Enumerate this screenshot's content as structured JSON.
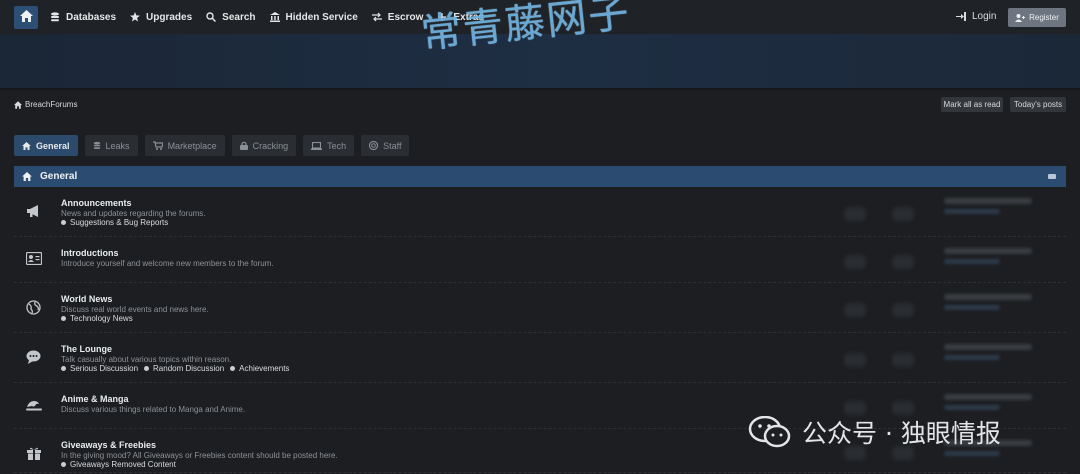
{
  "nav": {
    "items": [
      {
        "label": "Databases",
        "icon": "database-icon"
      },
      {
        "label": "Upgrades",
        "icon": "star-icon"
      },
      {
        "label": "Search",
        "icon": "search-icon"
      },
      {
        "label": "Hidden Service",
        "icon": "building-icon"
      },
      {
        "label": "Escrow",
        "icon": "swap-icon"
      },
      {
        "label": "Extras",
        "icon": "plus-icon"
      }
    ],
    "login": "Login",
    "register": "Register"
  },
  "watermark_top": "常青藤网子",
  "breadcrumb": "BreachForums",
  "actions": {
    "mark_read": "Mark all as read",
    "todays_posts": "Today's posts"
  },
  "tabs": [
    "General",
    "Leaks",
    "Marketplace",
    "Cracking",
    "Tech",
    "Staff"
  ],
  "section": {
    "title": "General"
  },
  "forums": [
    {
      "title": "Announcements",
      "desc": "News and updates regarding the forums.",
      "subs": [
        "Suggestions & Bug Reports"
      ],
      "icon": "megaphone-icon"
    },
    {
      "title": "Introductions",
      "desc": "Introduce yourself and welcome new members to the forum.",
      "subs": [],
      "icon": "id-card-icon"
    },
    {
      "title": "World News",
      "desc": "Discuss real world events and news here.",
      "subs": [
        "Technology News"
      ],
      "icon": "globe-icon"
    },
    {
      "title": "The Lounge",
      "desc": "Talk casually about various topics within reason.",
      "subs": [
        "Serious Discussion",
        "Random Discussion",
        "Achievements"
      ],
      "icon": "chat-icon"
    },
    {
      "title": "Anime & Manga",
      "desc": "Discuss various things related to Manga and Anime.",
      "subs": [],
      "icon": "wave-icon"
    },
    {
      "title": "Giveaways & Freebies",
      "desc": "In the giving mood? All Giveaways or Freebies content should be posted here.",
      "subs": [
        "Giveaways Removed Content"
      ],
      "icon": "gift-icon"
    }
  ],
  "watermark_bottom": "公众号 · 独眼情报",
  "colors": {
    "accent": "#2b4c70",
    "background": "#1c1e21"
  }
}
